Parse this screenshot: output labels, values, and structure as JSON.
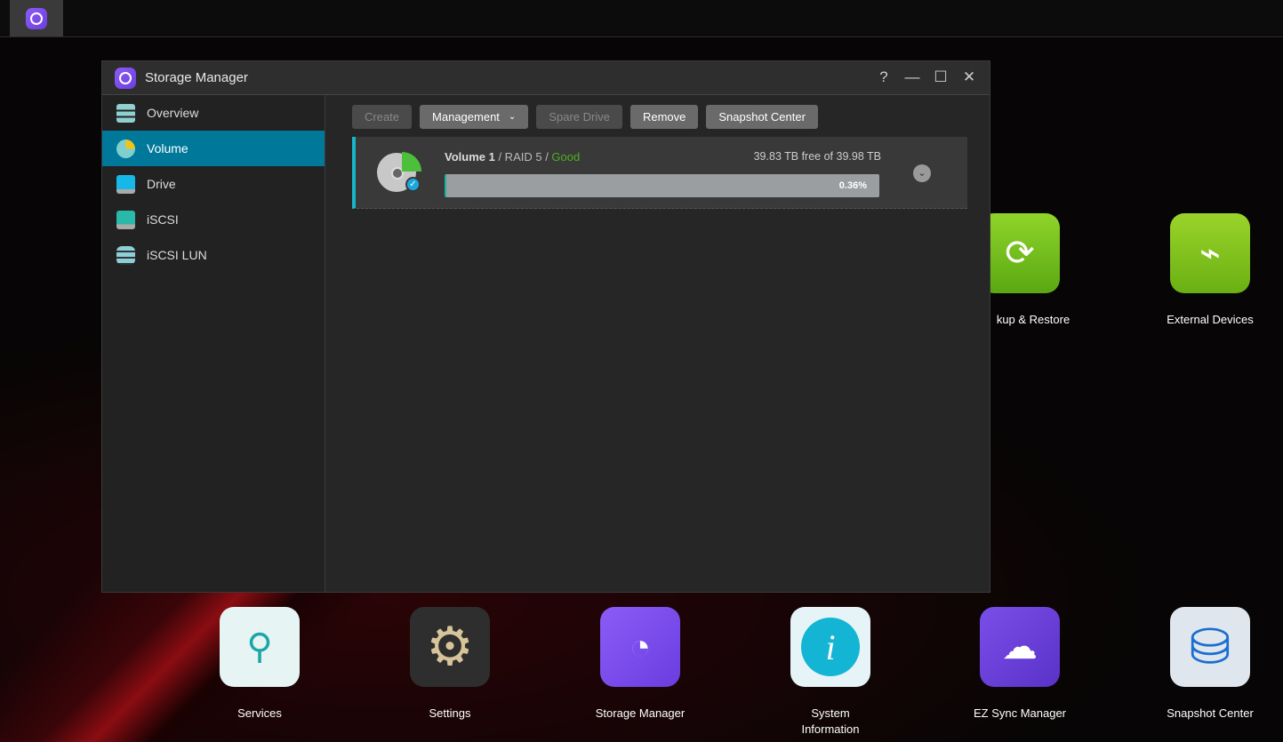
{
  "window": {
    "title": "Storage Manager",
    "help": "?",
    "minimize": "—",
    "maximize": "☐",
    "close": "✕"
  },
  "sidebar": {
    "items": [
      {
        "label": "Overview"
      },
      {
        "label": "Volume"
      },
      {
        "label": "Drive"
      },
      {
        "label": "iSCSI"
      },
      {
        "label": "iSCSI LUN"
      }
    ]
  },
  "toolbar": {
    "create": "Create",
    "management": "Management",
    "spare": "Spare Drive",
    "remove": "Remove",
    "snapshot": "Snapshot Center"
  },
  "volume": {
    "name": "Volume 1",
    "raid": " / RAID 5 / ",
    "status": "Good",
    "capacity": "39.83 TB free of 39.98 TB",
    "usage_label": "0.36%",
    "usage_percent": 0.36
  },
  "desktop": {
    "icons": [
      {
        "label": "kup & Restore"
      },
      {
        "label": "External Devices"
      },
      {
        "label": "Services"
      },
      {
        "label": "Settings"
      },
      {
        "label": "Storage Manager"
      },
      {
        "label": "System Information"
      },
      {
        "label": "EZ Sync Manager"
      },
      {
        "label": "Snapshot Center"
      }
    ]
  },
  "colors": {
    "accent": "#00789a",
    "good": "#4caf1e"
  }
}
